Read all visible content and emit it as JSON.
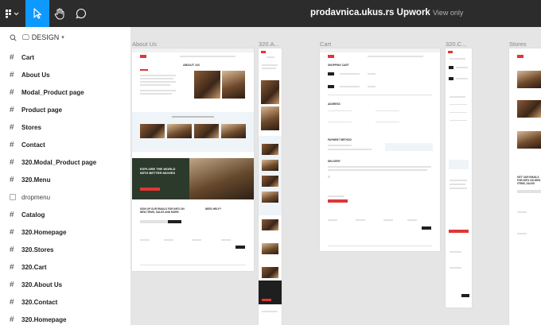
{
  "toolbar": {
    "file_title": "prodavnica.ukus.rs Upwork",
    "view_only": "View only",
    "icons": [
      "figma-menu-icon",
      "move-tool-icon",
      "hand-tool-icon",
      "comment-icon"
    ]
  },
  "sidebar": {
    "page_name": "DESIGN",
    "frames": [
      {
        "label": "Cart",
        "icon": "hash"
      },
      {
        "label": "About Us",
        "icon": "hash"
      },
      {
        "label": "Modal_Product page",
        "icon": "hash"
      },
      {
        "label": "Product page",
        "icon": "hash"
      },
      {
        "label": "Stores",
        "icon": "hash"
      },
      {
        "label": "Contact",
        "icon": "hash"
      },
      {
        "label": "320.Modal_Product page",
        "icon": "hash"
      },
      {
        "label": "320.Menu",
        "icon": "hash"
      },
      {
        "label": "dropmenu",
        "icon": "box"
      },
      {
        "label": "Catalog",
        "icon": "hash"
      },
      {
        "label": "320.Homepage",
        "icon": "hash"
      },
      {
        "label": "320.Stores",
        "icon": "hash"
      },
      {
        "label": "320.Cart",
        "icon": "hash"
      },
      {
        "label": "320.About Us",
        "icon": "hash"
      },
      {
        "label": "320.Contact",
        "icon": "hash"
      },
      {
        "label": "320.Homepage",
        "icon": "hash"
      }
    ]
  },
  "canvas": {
    "frame_labels": [
      "About Us",
      "320.A...",
      "Cart",
      "320.C...",
      "Stores"
    ],
    "about_frame": {
      "heading": "ABOUT US",
      "banner_text": "EXPLORE THE WORLD WITH BETTER MOVIES",
      "newsletter": "SIGN UP OUR EMAILS FOR INFO ON NEW ITEMS, SALES AND MORE.",
      "help": "NEED HELP?"
    },
    "cart_frame": {
      "heading": "SHOPPING CART",
      "address": "ADDRESS",
      "payment": "PAYMENT METHOD",
      "delivery": "DELIVERY"
    },
    "stores_frame": {
      "newsletter": "GET OUR EMAILS FOR INFO ON NEW ITEMS, SALES"
    }
  }
}
